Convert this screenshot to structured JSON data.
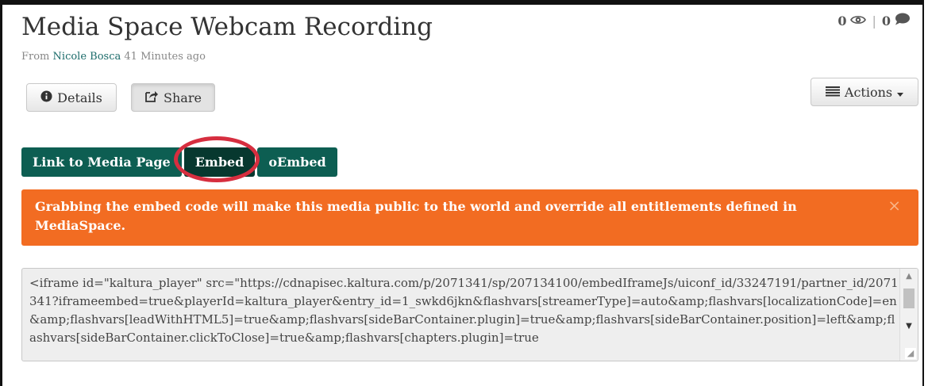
{
  "media": {
    "title": "Media Space Webcam Recording",
    "from_label": "From",
    "author": "Nicole Bosca",
    "time_ago": "41 Minutes ago"
  },
  "stats": {
    "views": "0",
    "comments": "0",
    "separator": "|"
  },
  "actions_bar": {
    "details_label": "Details",
    "share_label": "Share",
    "actions_label": "Actions"
  },
  "share_tabs": [
    {
      "label": "Link to Media Page"
    },
    {
      "label": "Embed"
    },
    {
      "label": "oEmbed"
    }
  ],
  "alert": {
    "text_before": "Grabbing the embed code will make this media",
    "emphasis": "public to the world",
    "text_after": "and override all entitlements defined in MediaSpace.",
    "close_symbol": "×",
    "color": "#f26c22"
  },
  "embed_code": {
    "value": "<iframe id=\"kaltura_player\" src=\"https://cdnapisec.kaltura.com/p/2071341/sp/207134100/embedIframeJs/uiconf_id/33247191/partner_id/2071341?iframeembed=true&playerId=kaltura_player&entry_id=1_swkd6jkn&flashvars[streamerType]=auto&amp;flashvars[localizationCode]=en&amp;flashvars[leadWithHTML5]=true&amp;flashvars[sideBarContainer.plugin]=true&amp;flashvars[sideBarContainer.position]=left&amp;flashvars[sideBarContainer.clickToClose]=true&amp;flashvars[chapters.plugin]=true"
  },
  "colors": {
    "tab": "#0d5e52",
    "tab_selected": "#07382f",
    "highlight": "#d62e3f",
    "author_link": "#1b6b6a"
  },
  "icons": {
    "views": "eye-icon",
    "comments": "speech-bubble-icon",
    "details": "info-circle-icon",
    "share": "share-icon",
    "actions": "list-icon"
  }
}
